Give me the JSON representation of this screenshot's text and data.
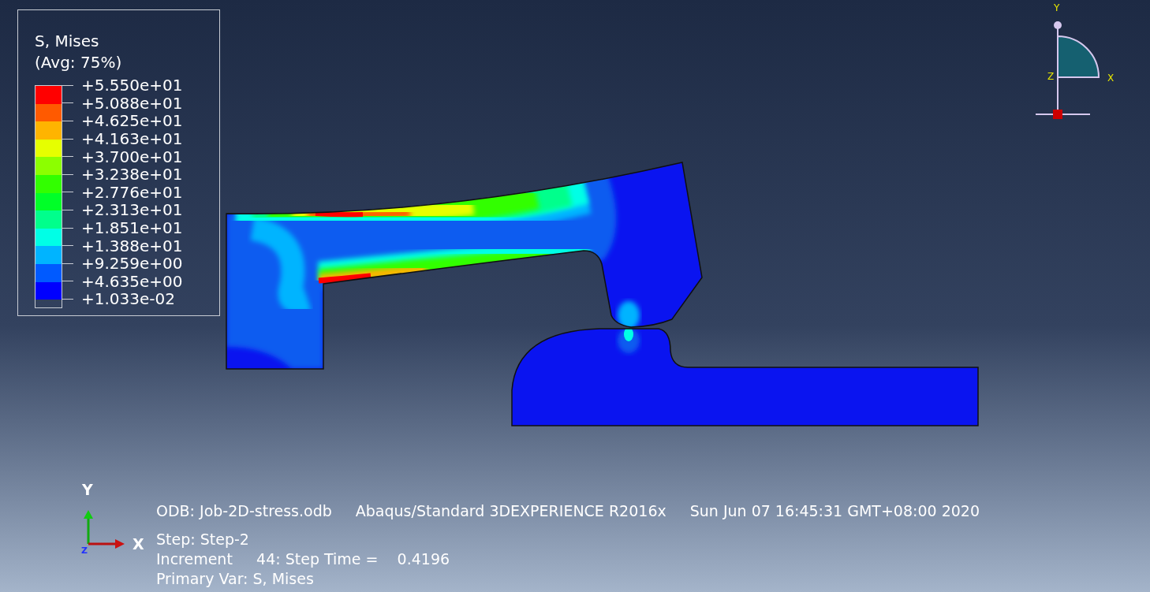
{
  "legend": {
    "title": "S, Mises",
    "subtitle": "(Avg: 75%)",
    "values": [
      "+5.550e+01",
      "+5.088e+01",
      "+4.625e+01",
      "+4.163e+01",
      "+3.700e+01",
      "+3.238e+01",
      "+2.776e+01",
      "+2.313e+01",
      "+1.851e+01",
      "+1.388e+01",
      "+9.259e+00",
      "+4.635e+00",
      "+1.033e-02"
    ],
    "bands": [
      {
        "color": "#ff0000"
      },
      {
        "color": "#ff5a00"
      },
      {
        "color": "#ffb400"
      },
      {
        "color": "#e6ff00"
      },
      {
        "color": "#8cff00"
      },
      {
        "color": "#32ff00"
      },
      {
        "color": "#00ff28"
      },
      {
        "color": "#00ff8c"
      },
      {
        "color": "#00ffe6"
      },
      {
        "color": "#00b4ff"
      },
      {
        "color": "#005aff"
      },
      {
        "color": "#0000ff"
      }
    ]
  },
  "view_triad": {
    "y_label": "Y",
    "z_label": "Z",
    "x_label": "X"
  },
  "axis_triad": {
    "y_label": "Y",
    "z_label": "Z",
    "x_label": "X"
  },
  "info": {
    "odb": "ODB: Job-2D-stress.odb",
    "solver": "Abaqus/Standard 3DEXPERIENCE R2016x",
    "date": "Sun Jun 07 16:45:31 GMT+08:00 2020",
    "step": "Step: Step-2",
    "increment": "Increment     44: Step Time =    0.4196",
    "primary_var": "Primary Var: S, Mises"
  }
}
